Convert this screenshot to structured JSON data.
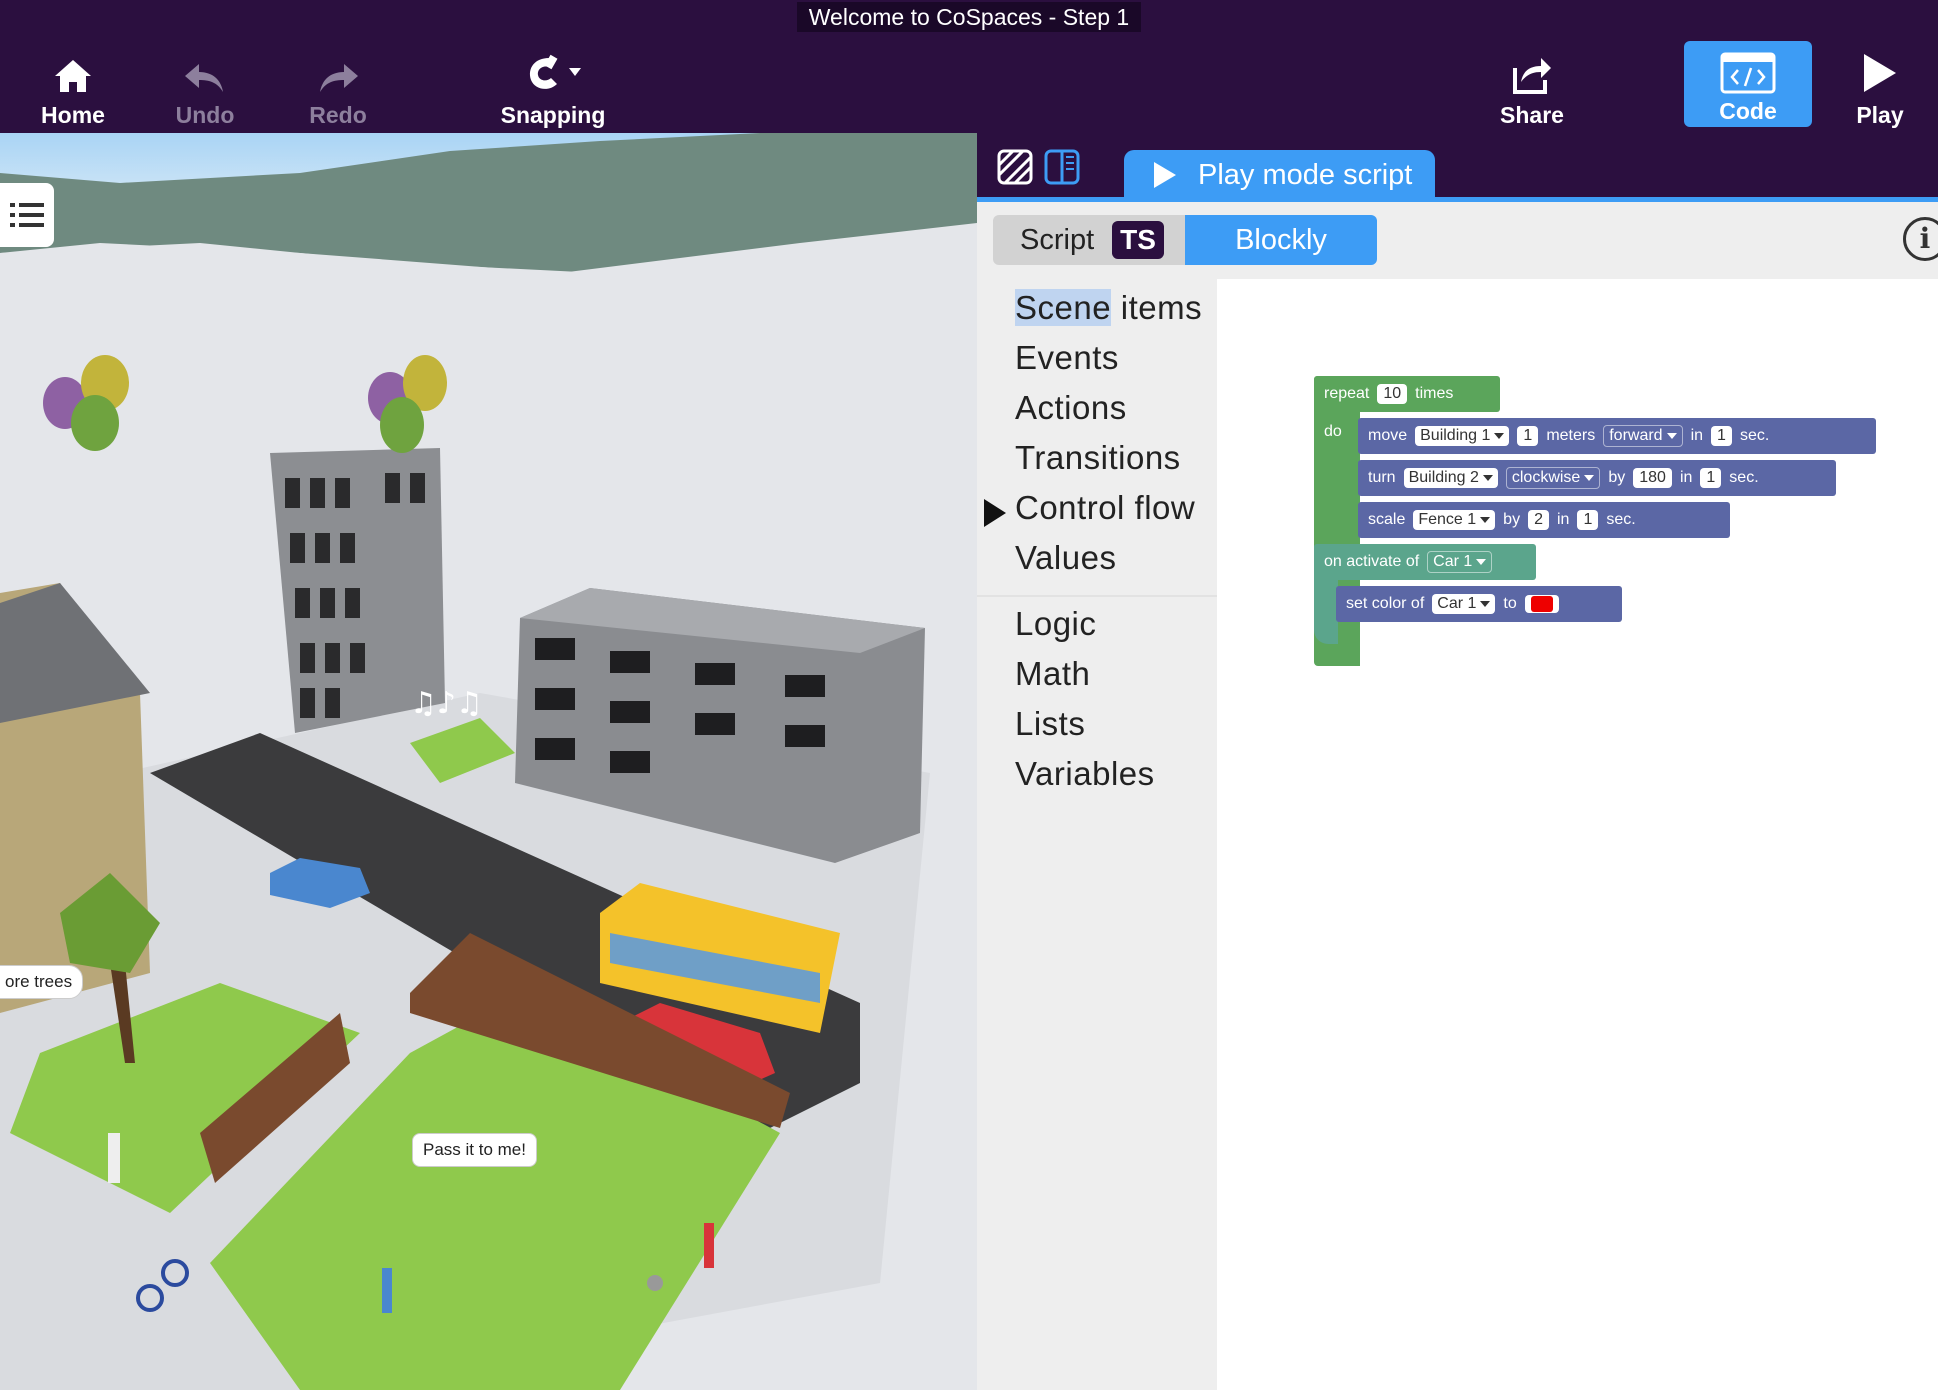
{
  "window_title": "Welcome to CoSpaces - Step 1",
  "toolbar": {
    "home": "Home",
    "undo": "Undo",
    "redo": "Redo",
    "snapping": "Snapping",
    "share": "Share",
    "code": "Code",
    "play": "Play"
  },
  "scene": {
    "bubble_trees": "ore trees",
    "bubble_pass": "Pass it to me!"
  },
  "editor": {
    "tab_label": "Play mode script",
    "mode_script": "Script",
    "mode_ts": "TS",
    "mode_blockly": "Blockly",
    "info": "i",
    "categories_top": [
      "Scene items",
      "Events",
      "Actions",
      "Transitions",
      "Control flow",
      "Values"
    ],
    "scene_highlight": "Scene",
    "scene_rest": " items",
    "categories_bottom": [
      "Logic",
      "Math",
      "Lists",
      "Variables"
    ]
  },
  "blocks": {
    "repeat": "repeat",
    "repeat_count": "10",
    "times": "times",
    "do": "do",
    "move": "move",
    "move_target": "Building 1",
    "move_dist": "1",
    "meters": "meters",
    "direction": "forward",
    "in": "in",
    "move_time": "1",
    "sec": "sec.",
    "turn": "turn",
    "turn_target": "Building 2",
    "turn_dir": "clockwise",
    "by": "by",
    "turn_angle": "180",
    "turn_time": "1",
    "scale": "scale",
    "scale_target": "Fence 1",
    "scale_by": "2",
    "scale_time": "1",
    "on_activate": "on activate of",
    "activate_target": "Car 1",
    "set_color": "set color of",
    "color_target": "Car 1",
    "to": "to",
    "color_value": "#ee0000"
  }
}
